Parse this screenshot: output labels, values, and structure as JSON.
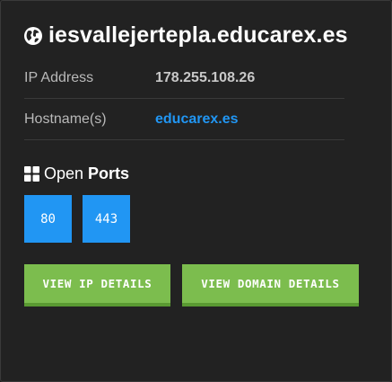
{
  "header": {
    "title": "iesvallejertepla.educarex.es",
    "icon": "globe-icon"
  },
  "info": [
    {
      "label": "IP Address",
      "value": "178.255.108.26",
      "is_link": false
    },
    {
      "label": "Hostname(s)",
      "value": "educarex.es",
      "is_link": true
    }
  ],
  "ports_section": {
    "icon": "grid-icon",
    "title_prefix": "Open",
    "title_bold": "Ports"
  },
  "ports": [
    "80",
    "443"
  ],
  "buttons": {
    "ip_details": "VIEW IP DETAILS",
    "domain_details": "VIEW DOMAIN DETAILS"
  },
  "colors": {
    "background": "#222222",
    "accent_blue": "#2196f3",
    "button_green": "#7cbd4e",
    "label_gray": "#b9b9b9"
  }
}
